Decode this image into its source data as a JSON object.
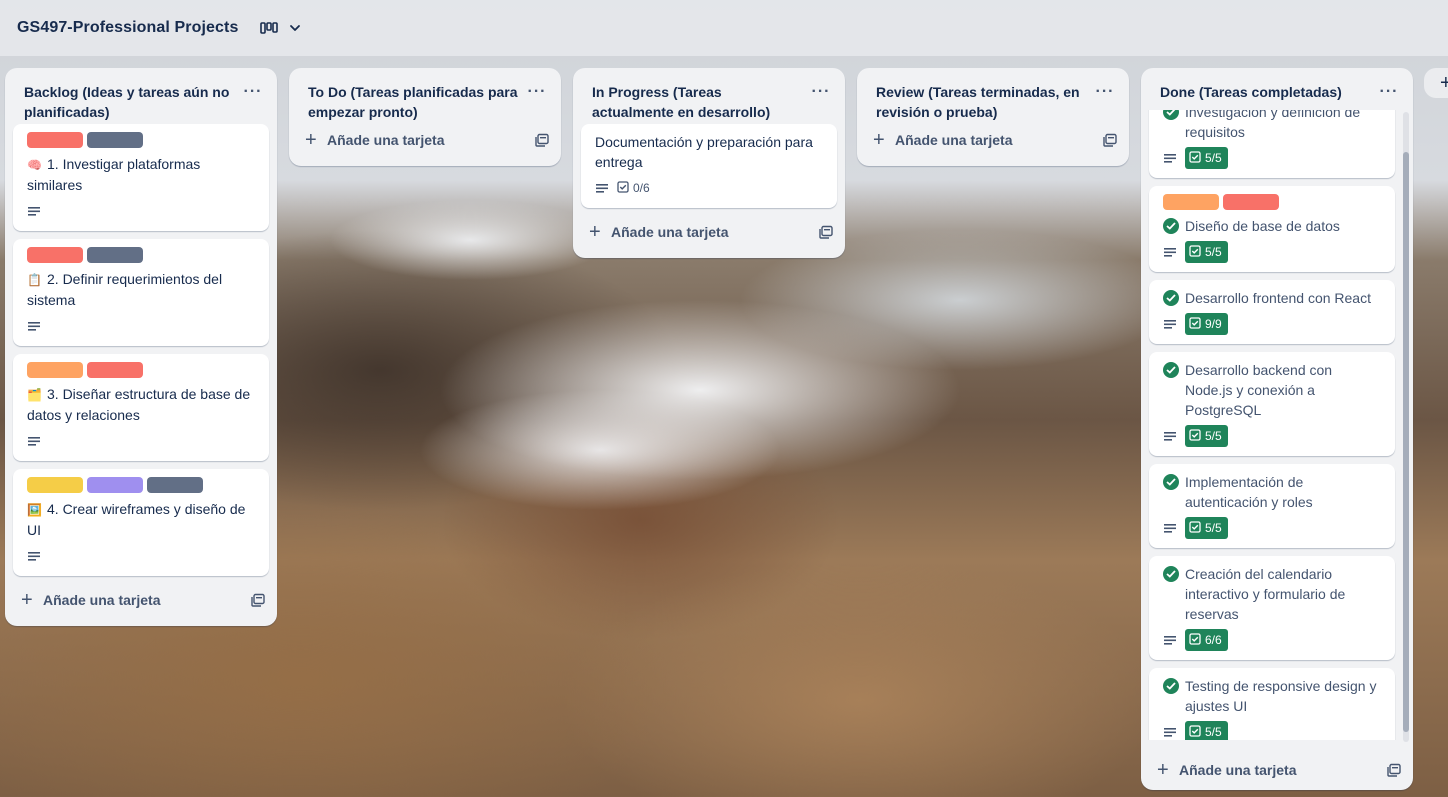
{
  "board": {
    "title": "GS497-Professional Projects",
    "view_icon": "board-columns-icon",
    "menu_icon": "chevron-down-icon"
  },
  "colors": {
    "red": "#f87168",
    "dark": "#626f86",
    "orange": "#fea362",
    "yellow": "#f5cd47",
    "purple": "#9f8fef",
    "green": "#1f845a"
  },
  "common": {
    "menu": "···",
    "add_card": "Añade una tarjeta",
    "add_icon": "+",
    "add_list": "+"
  },
  "lists": [
    {
      "title": "Backlog (Ideas y tareas aún no planificadas)",
      "cards": [
        {
          "emoji": "🧠",
          "title": "1. Investigar plataformas similares",
          "labels": [
            "red",
            "dark"
          ]
        },
        {
          "emoji": "📋",
          "title": "2. Definir requerimientos del sistema",
          "labels": [
            "red",
            "dark"
          ]
        },
        {
          "emoji": "🗂️",
          "title": "3. Diseñar estructura de base de datos y relaciones",
          "labels": [
            "orange",
            "red"
          ]
        },
        {
          "emoji": "🖼️",
          "title": "4. Crear wireframes y diseño de UI",
          "labels": [
            "yellow",
            "purple",
            "dark"
          ]
        }
      ]
    },
    {
      "title": "To Do (Tareas planificadas para empezar pronto)",
      "cards": []
    },
    {
      "title": "In Progress (Tareas actualmente en desarrollo)",
      "cards": [
        {
          "title": "Documentación y preparación para entrega",
          "checklist": "0/6"
        }
      ]
    },
    {
      "title": "Review (Tareas terminadas, en revisión o prueba)",
      "cards": []
    },
    {
      "title": "Done (Tareas completadas)",
      "cards": [
        {
          "title": "Investigación y definición de requisitos",
          "checklist": "5/5"
        },
        {
          "title": "Diseño de base de datos",
          "checklist": "5/5",
          "labels": [
            "orange",
            "red"
          ]
        },
        {
          "title": "Desarrollo frontend con React",
          "checklist": "9/9"
        },
        {
          "title": "Desarrollo backend con Node.js y conexión a PostgreSQL",
          "checklist": "5/5"
        },
        {
          "title": "Implementación de autenticación y roles",
          "checklist": "5/5"
        },
        {
          "title": "Creación del calendario interactivo y formulario de reservas",
          "checklist": "6/6"
        },
        {
          "title": "Testing de responsive design y ajustes UI",
          "checklist": "5/5"
        }
      ]
    }
  ]
}
